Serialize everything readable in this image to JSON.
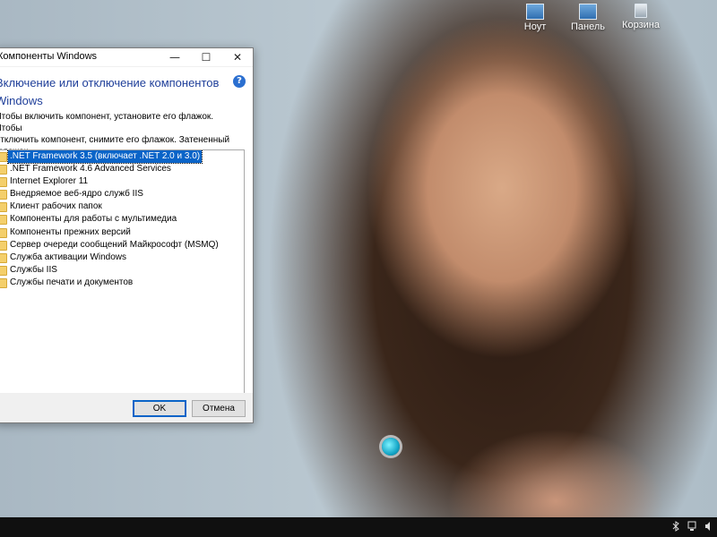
{
  "desktop": {
    "icons": [
      {
        "label": "Ноут",
        "icon": "computer-icon"
      },
      {
        "label": "Панель",
        "icon": "control-panel-icon"
      },
      {
        "label": "Корзина",
        "icon": "recycle-bin-icon"
      }
    ]
  },
  "window": {
    "title": "Компоненты Windows",
    "minimize": "—",
    "maximize": "☐",
    "close": "✕",
    "heading": "Включение или отключение компонентов\nWindows",
    "help": "?",
    "description": "Чтобы включить компонент, установите его флажок. Чтобы\nотключить компонент, снимите его флажок. Затененный флажок\nозначает, что компонент включен частично.",
    "features": [
      {
        "label": ".NET Framework 3.5 (включает .NET 2.0 и 3.0)",
        "selected": true
      },
      {
        "label": ".NET Framework 4.6 Advanced Services",
        "selected": false
      },
      {
        "label": "Internet Explorer 11",
        "selected": false
      },
      {
        "label": "Внедряемое веб-ядро служб IIS",
        "selected": false
      },
      {
        "label": "Клиент рабочих папок",
        "selected": false
      },
      {
        "label": "Компоненты для работы с мультимедиа",
        "selected": false
      },
      {
        "label": "Компоненты прежних версий",
        "selected": false
      },
      {
        "label": "Сервер очереди сообщений Майкрософт (MSMQ)",
        "selected": false
      },
      {
        "label": "Служба активации Windows",
        "selected": false
      },
      {
        "label": "Службы IIS",
        "selected": false
      },
      {
        "label": "Службы печати и документов",
        "selected": false
      }
    ],
    "ok_label": "OK",
    "cancel_label": "Отмена"
  },
  "taskbar": {
    "tray_icons": [
      "bluetooth-icon",
      "network-icon",
      "volume-icon"
    ]
  }
}
